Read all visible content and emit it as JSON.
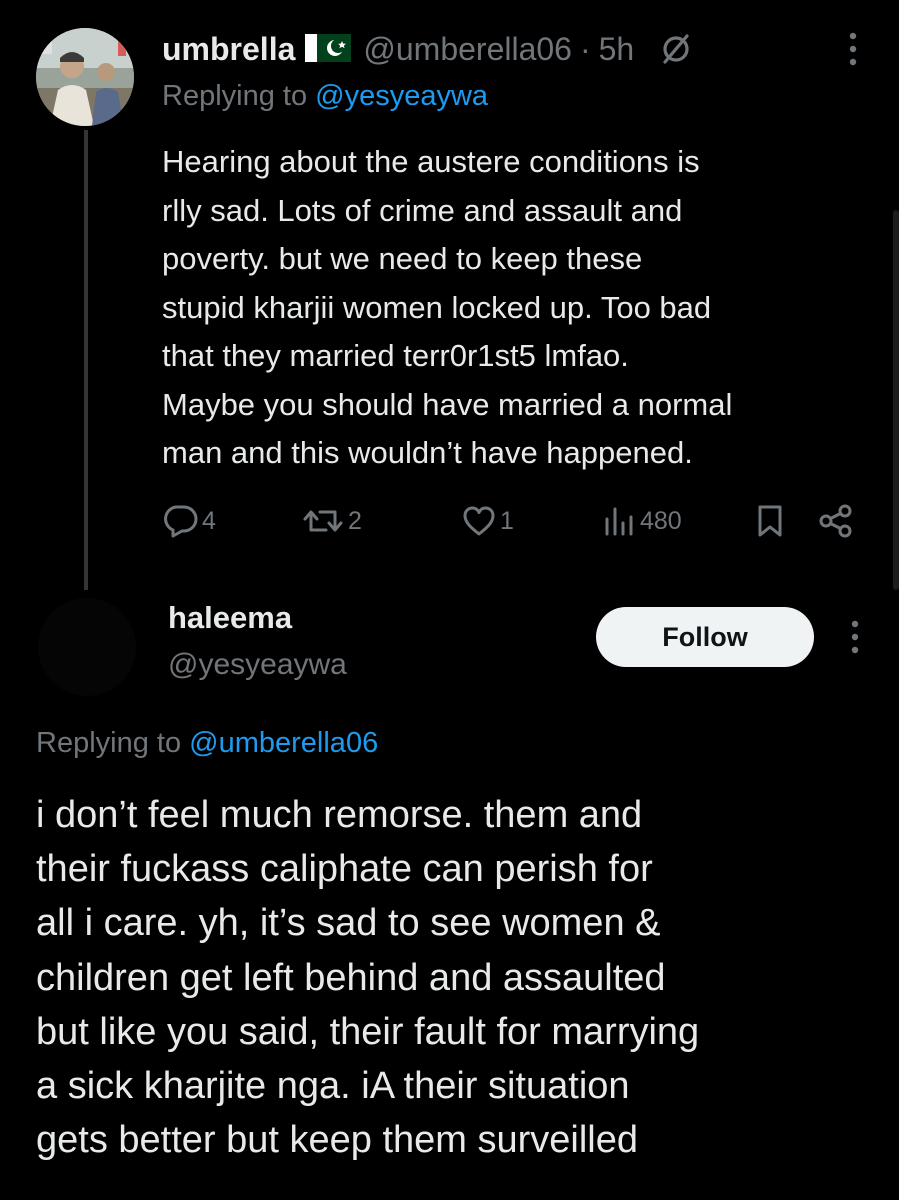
{
  "reply_tweet": {
    "author": {
      "display_name": "umbrella",
      "handle": "@umberella06",
      "flag_icon": "pakistan-flag-icon"
    },
    "separator": "·",
    "time": "5h",
    "replying_to_label": "Replying to",
    "replying_to_handle": "@yesyeaywa",
    "body_lines": [
      "Hearing about the austere conditions is",
      "rlly sad. Lots of crime and assault and",
      "poverty. but we need to keep these",
      "stupid kharjii women locked up. Too bad",
      "that they married terr0r1st5 lmfao.",
      "Maybe you should have married a normal",
      "man and this wouldn’t have happened."
    ],
    "actions": {
      "replies": "4",
      "reposts": "2",
      "likes": "1",
      "views": "480"
    }
  },
  "main_tweet": {
    "author": {
      "display_name": "haleema",
      "handle": "@yesyeaywa"
    },
    "follow_label": "Follow",
    "replying_to_label": "Replying to",
    "replying_to_handle": "@umberella06",
    "body_lines": [
      "i don’t feel much remorse. them and",
      "their fuckass caliphate can perish for",
      "all i care. yh, it’s sad to see women &",
      "children get left behind and assaulted",
      "but like you said, their fault for marrying",
      "a sick kharjite nga.  iA their situation",
      "gets better but keep them surveilled"
    ]
  },
  "colors": {
    "background": "#000000",
    "text": "#e7e9ea",
    "muted": "#71767b",
    "link": "#1d9bf0",
    "follow_button_bg": "#eff3f4",
    "thread_line": "#333639"
  }
}
